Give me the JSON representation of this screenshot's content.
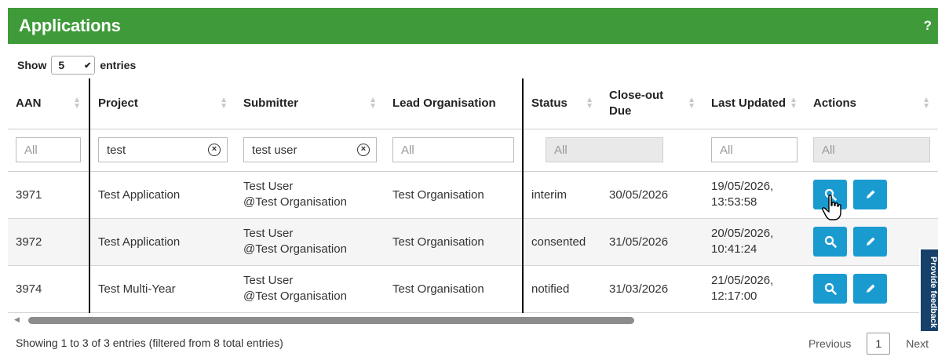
{
  "header": {
    "title": "Applications",
    "help": "?"
  },
  "length": {
    "show_label": "Show",
    "value": "5",
    "entries_label": "entries"
  },
  "columns": {
    "aan": "AAN",
    "project": "Project",
    "submitter": "Submitter",
    "lead": "Lead Organisation",
    "status": "Status",
    "closeout_line1": "Close-out",
    "closeout_line2": "Due",
    "updated": "Last Updated",
    "actions": "Actions"
  },
  "filters": {
    "aan": "All",
    "project": "test",
    "submitter": "test user",
    "lead": "All",
    "status": "All",
    "closeout": "All",
    "updated": "All",
    "actions": "All"
  },
  "rows": [
    {
      "aan": "3971",
      "project": "Test Application",
      "sub1": "Test User",
      "sub2": "@Test Organisation",
      "lead": "Test Organisation",
      "status": "interim",
      "due": "30/05/2026",
      "upd1": "19/05/2026,",
      "upd2": "13:53:58"
    },
    {
      "aan": "3972",
      "project": "Test Application",
      "sub1": "Test User",
      "sub2": "@Test Organisation",
      "lead": "Test Organisation",
      "status": "consented",
      "due": "31/05/2026",
      "upd1": "20/05/2026,",
      "upd2": "10:41:24"
    },
    {
      "aan": "3974",
      "project": "Test Multi-Year",
      "sub1": "Test User",
      "sub2": "@Test Organisation",
      "lead": "Test Organisation",
      "status": "notified",
      "due": "31/03/2026",
      "upd1": "21/05/2026,",
      "upd2": "12:17:00"
    }
  ],
  "info": "Showing 1 to 3 of 3 entries (filtered from 8 total entries)",
  "pager": {
    "previous": "Previous",
    "current": "1",
    "next": "Next"
  },
  "feedback": "Provide feedback",
  "colors": {
    "header_green": "#3f9b3a",
    "action_blue": "#1a9bd0",
    "overdue_red": "#c0392b",
    "feedback_navy": "#17416a"
  }
}
